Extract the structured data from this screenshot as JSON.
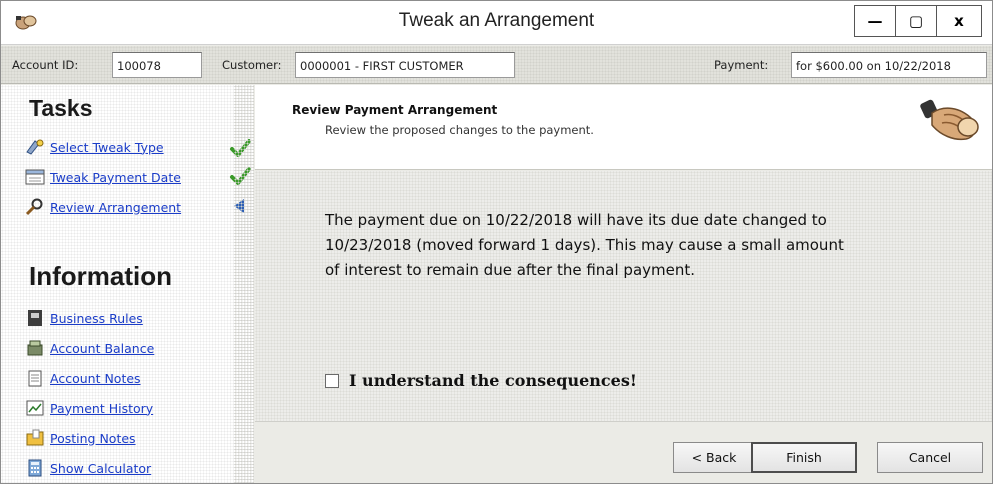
{
  "window": {
    "title": "Tweak an Arrangement",
    "controls": {
      "minimize": "—",
      "maximize": "▢",
      "close": "x"
    }
  },
  "infobar": {
    "account_label": "Account ID:",
    "account_value": "100078",
    "customer_label": "Customer:",
    "customer_value": "0000001 - FIRST CUSTOMER",
    "payment_label": "Payment:",
    "payment_value": "for $600.00 on 10/22/2018"
  },
  "sidebar": {
    "tasks_heading": "Tasks",
    "tasks": [
      {
        "label": "Select Tweak Type",
        "icon": "wizard-icon",
        "status": "complete"
      },
      {
        "label": "Tweak Payment Date",
        "icon": "calendar-icon",
        "status": "complete"
      },
      {
        "label": "Review Arrangement",
        "icon": "magnifier-icon",
        "status": "current"
      }
    ],
    "information_heading": "Information",
    "information": [
      {
        "label": "Business Rules",
        "icon": "rules-book-icon"
      },
      {
        "label": "Account Balance",
        "icon": "cash-register-icon"
      },
      {
        "label": "Account Notes",
        "icon": "notepad-icon"
      },
      {
        "label": "Payment History",
        "icon": "chart-icon"
      },
      {
        "label": "Posting Notes",
        "icon": "folder-notes-icon"
      },
      {
        "label": "Show Calculator",
        "icon": "calculator-icon"
      }
    ]
  },
  "main": {
    "step_title": "Review Payment Arrangement",
    "step_subtitle": "Review the proposed changes to the payment.",
    "message": "The payment due on 10/22/2018 will have its due date changed to 10/23/2018 (moved forward 1 days).  This may cause a small amount of interest to remain due after the final payment.",
    "consent_label": "I understand the consequences!",
    "consent_checked": false
  },
  "footer": {
    "back_label": "< Back",
    "finish_label": "Finish",
    "cancel_label": "Cancel"
  },
  "colors": {
    "link": "#1a3cc8",
    "check": "#3a9a2a",
    "current_marker": "#2d5fb5"
  }
}
